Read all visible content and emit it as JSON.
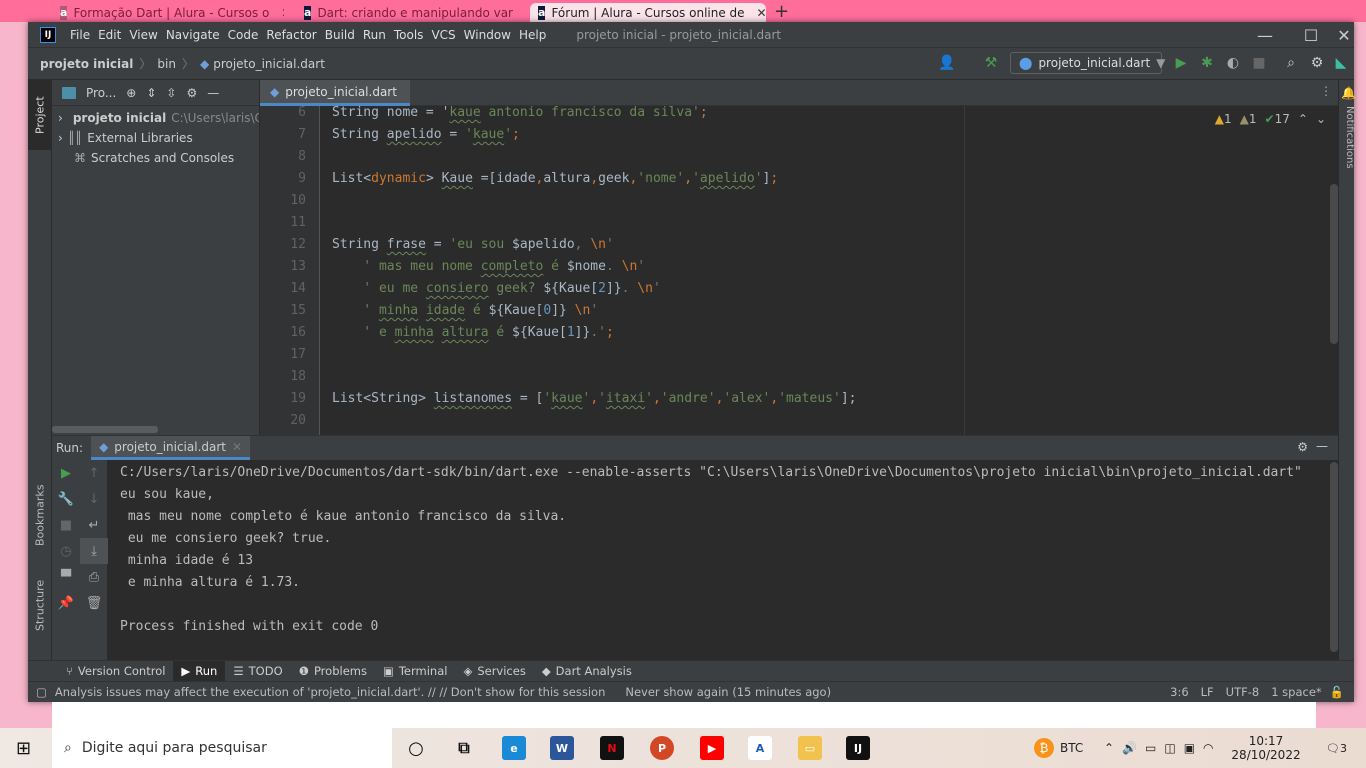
{
  "browser": {
    "tabs": [
      {
        "title": "Formação Dart | Alura - Cursos o"
      },
      {
        "title": "Dart: criando e manipulando var"
      },
      {
        "title": "Fórum | Alura - Cursos online de"
      }
    ],
    "new_tab": "+"
  },
  "ide": {
    "menu": [
      "File",
      "Edit",
      "View",
      "Navigate",
      "Code",
      "Refactor",
      "Build",
      "Run",
      "Tools",
      "VCS",
      "Window",
      "Help"
    ],
    "window_title": "projeto inicial - projeto_inicial.dart",
    "breadcrumb": [
      "projeto inicial",
      "bin",
      "projeto_inicial.dart"
    ],
    "run_config": "projeto_inicial.dart",
    "left_stripe": [
      "Project",
      "Bookmarks",
      "Structure"
    ],
    "right_stripe": "Notifications",
    "project_panel": {
      "title": "Pro...",
      "tree": [
        {
          "label": "projeto inicial",
          "path": "C:\\Users\\laris\\O"
        },
        {
          "label": "External Libraries"
        },
        {
          "label": "Scratches and Consoles"
        }
      ]
    },
    "editor": {
      "tab": "projeto_inicial.dart",
      "inspections": {
        "warnings": "1",
        "weak_warnings": "1",
        "typos": "17"
      },
      "lines": [
        {
          "n": "6",
          "t": [
            [
              "String nome = ",
              ""
            ],
            [
              "'",
              ""
            ],
            [
              "kaue",
              "s w"
            ],
            [
              " antonio francisco da silva'",
              "s"
            ],
            [
              ";",
              "k"
            ]
          ]
        },
        {
          "n": "7",
          "t": [
            [
              "String ",
              ""
            ],
            [
              "apelido",
              "w"
            ],
            [
              " = ",
              ""
            ],
            [
              "'",
              "s"
            ],
            [
              "kaue",
              "s w"
            ],
            [
              "'",
              "s"
            ],
            [
              ";",
              "k"
            ]
          ]
        },
        {
          "n": "8",
          "t": []
        },
        {
          "n": "9",
          "t": [
            [
              "List<",
              ""
            ],
            [
              "dynamic",
              "k"
            ],
            [
              "> ",
              ""
            ],
            [
              "Kaue",
              "w"
            ],
            [
              " =[idade",
              ""
            ],
            [
              ",",
              "k"
            ],
            [
              "altura",
              ""
            ],
            [
              ",",
              "k"
            ],
            [
              "geek",
              ""
            ],
            [
              ",",
              "k"
            ],
            [
              "'nome'",
              "s"
            ],
            [
              ",",
              "k"
            ],
            [
              "'",
              "s"
            ],
            [
              "apelido",
              "s w"
            ],
            [
              "'",
              "s"
            ],
            [
              "]",
              ""
            ],
            [
              ";",
              "k"
            ]
          ]
        },
        {
          "n": "10",
          "t": []
        },
        {
          "n": "11",
          "t": []
        },
        {
          "n": "12",
          "t": [
            [
              "String ",
              ""
            ],
            [
              "frase",
              "w"
            ],
            [
              " = ",
              ""
            ],
            [
              "'eu sou ",
              "s"
            ],
            [
              "$apelido",
              ""
            ],
            [
              ", ",
              "s"
            ],
            [
              "\\n",
              "k"
            ],
            [
              "'",
              "s"
            ]
          ]
        },
        {
          "n": "13",
          "t": [
            [
              "    ' mas meu nome ",
              "s"
            ],
            [
              "completo",
              "s w"
            ],
            [
              " é ",
              "s"
            ],
            [
              "$nome",
              ""
            ],
            [
              ". ",
              "s"
            ],
            [
              "\\n",
              "k"
            ],
            [
              "'",
              "s"
            ]
          ]
        },
        {
          "n": "14",
          "t": [
            [
              "    ' eu me ",
              "s"
            ],
            [
              "consiero",
              "s w"
            ],
            [
              " geek? ",
              "s"
            ],
            [
              "${Kaue[",
              ""
            ],
            [
              "2",
              "n"
            ],
            [
              "]}",
              ""
            ],
            [
              ". ",
              "s"
            ],
            [
              "\\n",
              "k"
            ],
            [
              "'",
              "s"
            ]
          ]
        },
        {
          "n": "15",
          "t": [
            [
              "    ' ",
              "s"
            ],
            [
              "minha",
              "s w"
            ],
            [
              " ",
              "s"
            ],
            [
              "idade",
              "s w"
            ],
            [
              " é ",
              "s"
            ],
            [
              "${Kaue[",
              ""
            ],
            [
              "0",
              "n"
            ],
            [
              "]}",
              ""
            ],
            [
              " ",
              "s"
            ],
            [
              "\\n",
              "k"
            ],
            [
              "'",
              "s"
            ]
          ]
        },
        {
          "n": "16",
          "t": [
            [
              "    ' e ",
              "s"
            ],
            [
              "minha",
              "s w"
            ],
            [
              " ",
              "s"
            ],
            [
              "altura",
              "s w"
            ],
            [
              " é ",
              "s"
            ],
            [
              "${Kaue[",
              ""
            ],
            [
              "1",
              "n"
            ],
            [
              "]}",
              ""
            ],
            [
              ".'",
              "s"
            ],
            [
              ";",
              "k"
            ]
          ]
        },
        {
          "n": "17",
          "t": []
        },
        {
          "n": "18",
          "t": []
        },
        {
          "n": "19",
          "t": [
            [
              "List<String> ",
              ""
            ],
            [
              "listanomes",
              "w"
            ],
            [
              " = [",
              ""
            ],
            [
              "'",
              "s"
            ],
            [
              "kaue",
              "s w"
            ],
            [
              "'",
              "s"
            ],
            [
              ",",
              "k"
            ],
            [
              "'",
              "s"
            ],
            [
              "itaxi",
              "s w"
            ],
            [
              "'",
              "s"
            ],
            [
              ",",
              "k"
            ],
            [
              "'andre'",
              "s"
            ],
            [
              ",",
              "k"
            ],
            [
              "'alex'",
              "s"
            ],
            [
              ",",
              "k"
            ],
            [
              "'mateus'",
              "s"
            ],
            [
              "];",
              ""
            ]
          ]
        },
        {
          "n": "20",
          "t": []
        }
      ]
    },
    "run": {
      "label": "Run:",
      "tab": "projeto_inicial.dart",
      "output": [
        "C:/Users/laris/OneDrive/Documentos/dart-sdk/bin/dart.exe --enable-asserts \"C:\\Users\\laris\\OneDrive\\Documentos\\projeto inicial\\bin\\projeto_inicial.dart\"",
        "eu sou kaue,",
        " mas meu nome completo é kaue antonio francisco da silva.",
        " eu me consiero geek? true.",
        " minha idade é 13",
        " e minha altura é 1.73.",
        "",
        "Process finished with exit code 0"
      ]
    },
    "tool_tabs": [
      "Version Control",
      "Run",
      "TODO",
      "Problems",
      "Terminal",
      "Services",
      "Dart Analysis"
    ],
    "status": {
      "message": "Analysis issues may affect the execution of 'projeto_inicial.dart'. // // Don't show for this session",
      "never": "Never show again (15 minutes ago)",
      "position": "3:6",
      "line_sep": "LF",
      "encoding": "UTF-8",
      "indent": "1 space*"
    }
  },
  "taskbar": {
    "search_placeholder": "Digite aqui para pesquisar",
    "btc": "BTC",
    "time": "10:17",
    "date": "28/10/2022",
    "notifications": "3"
  },
  "colors": {
    "accent": "#4a88c7",
    "string": "#6a8759",
    "keyword": "#cc7832",
    "number": "#6897bb"
  }
}
